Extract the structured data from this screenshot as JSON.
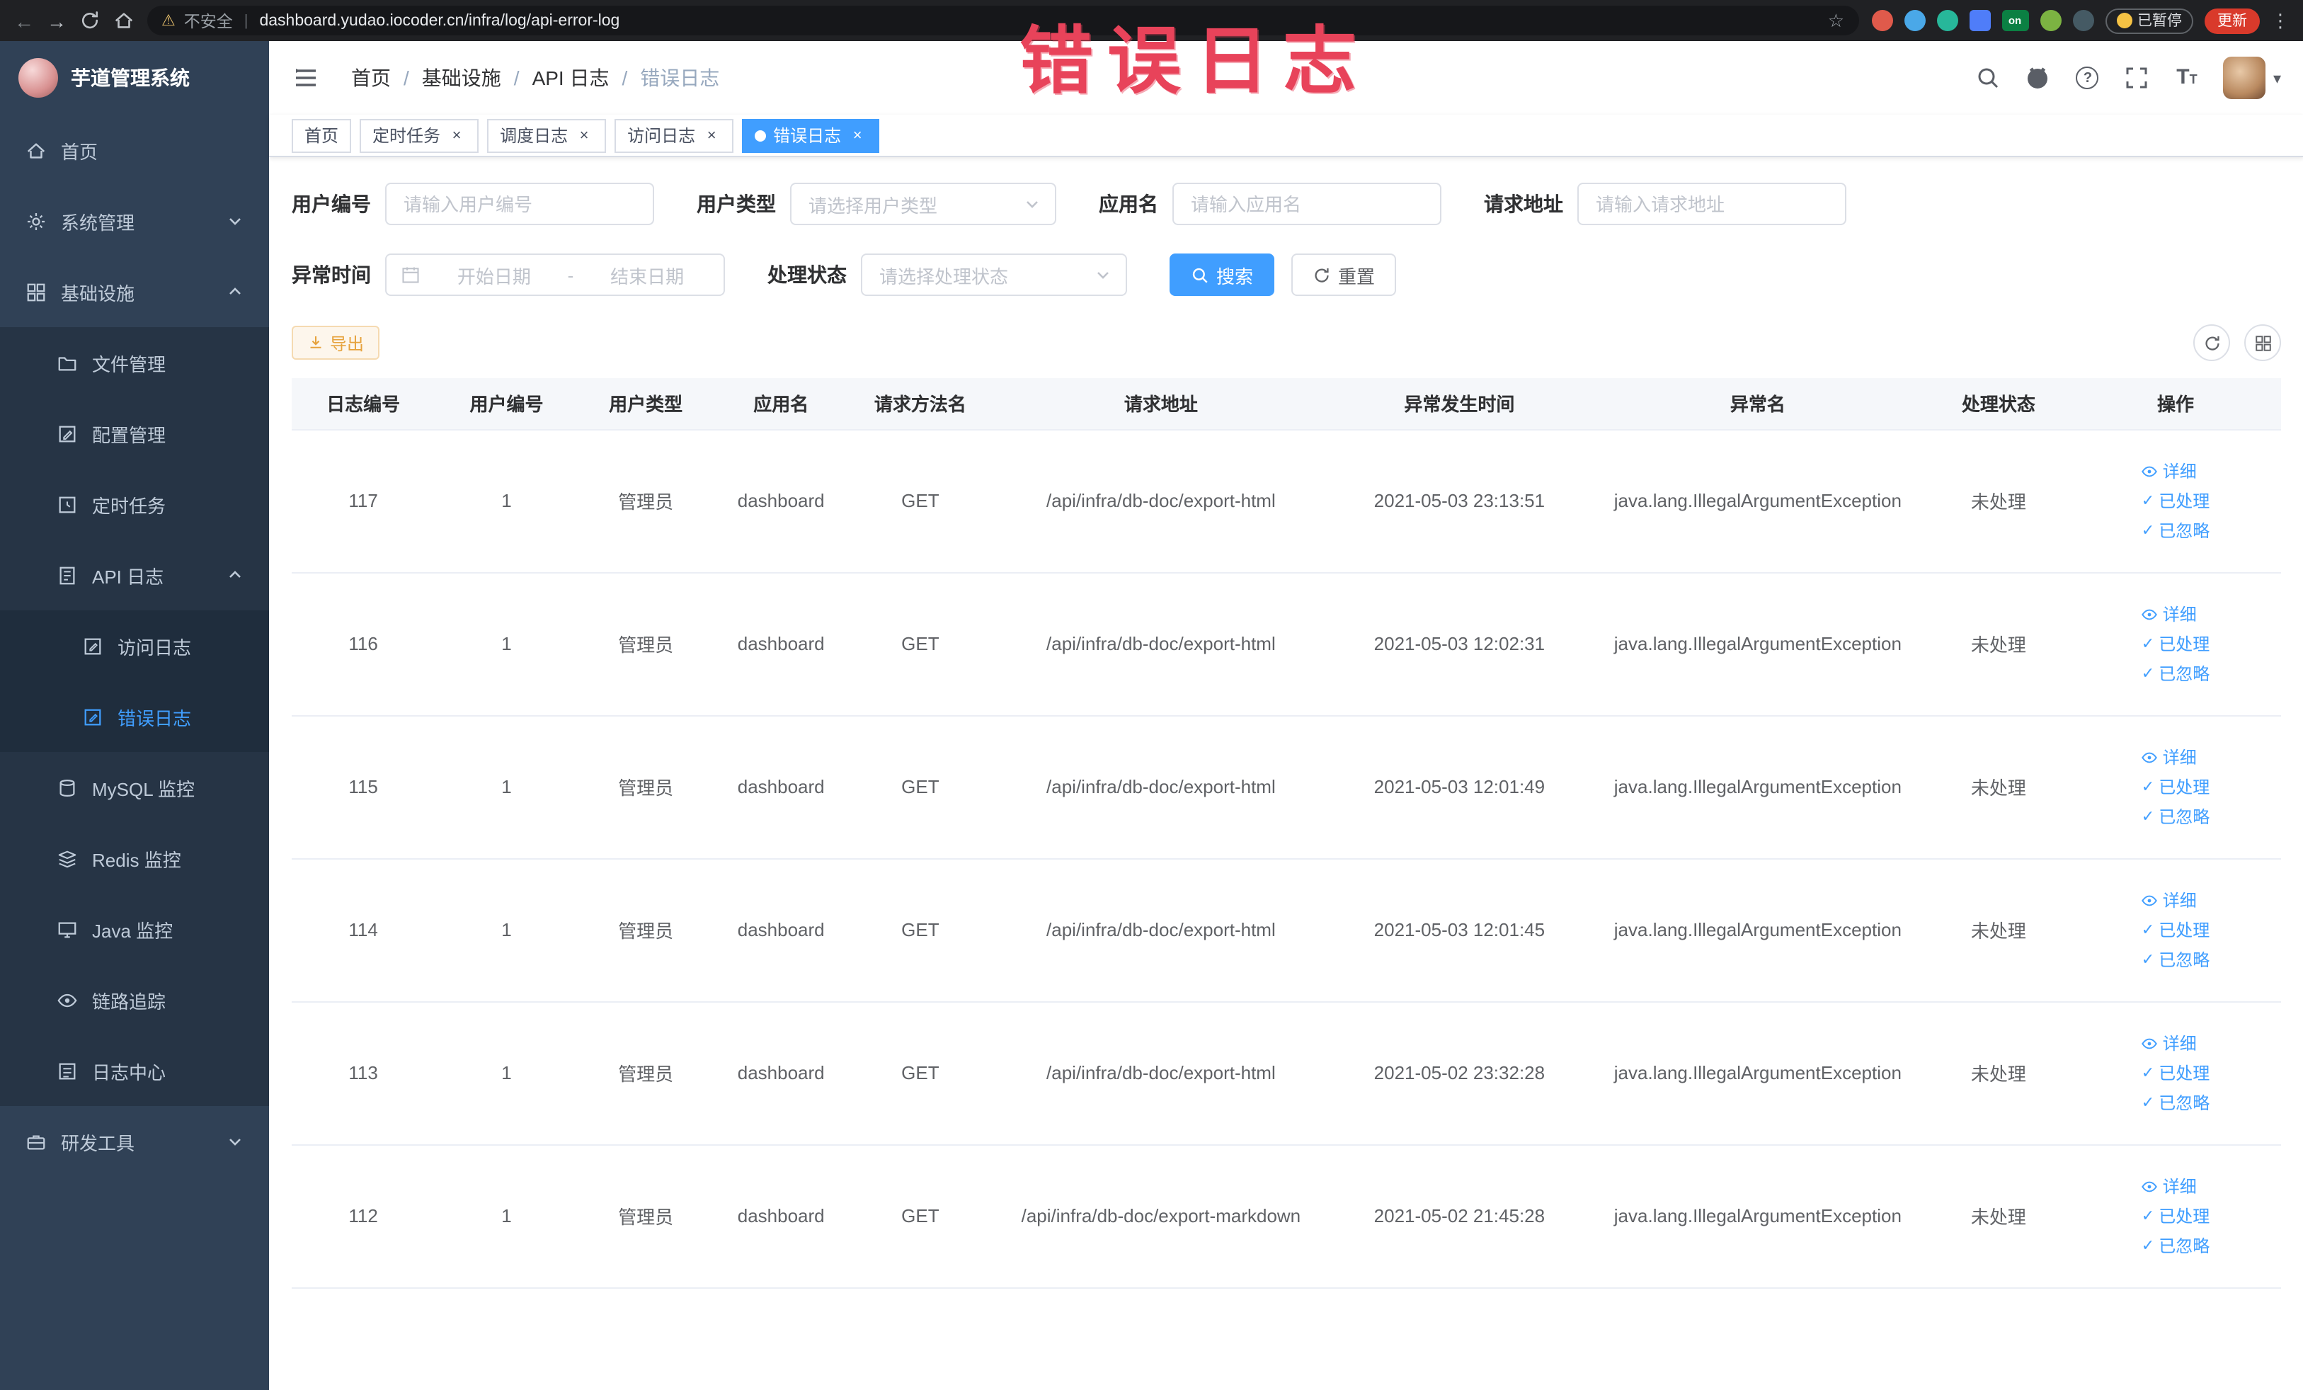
{
  "colors": {
    "accent": "#409EFF",
    "warning": "#E6A23C",
    "annotation": "#E8435A",
    "sidebar_bg": "#304156",
    "active_tab": "#409EFF"
  },
  "glyphs": {
    "back": "←",
    "forward": "→",
    "warning": "⚠",
    "pipe": "|",
    "star": "☆",
    "kebab": "⋮",
    "check": "✓",
    "close": "×",
    "caret": "▾",
    "separator": "/",
    "question": "?",
    "font": "T"
  },
  "browser": {
    "security_text": "不安全",
    "url": "dashboard.yudao.iocoder.cn/infra/log/api-error-log",
    "paused_label": "已暂停",
    "update_label": "更新",
    "extension_on_label": "on"
  },
  "annotation": {
    "text": "错误日志"
  },
  "sidebar": {
    "title": "芋道管理系统",
    "items": [
      {
        "label": "首页"
      },
      {
        "label": "系统管理"
      },
      {
        "label": "基础设施"
      },
      {
        "label": "文件管理"
      },
      {
        "label": "配置管理"
      },
      {
        "label": "定时任务"
      },
      {
        "label": "API 日志"
      },
      {
        "label": "访问日志"
      },
      {
        "label": "错误日志"
      },
      {
        "label": "MySQL 监控"
      },
      {
        "label": "Redis 监控"
      },
      {
        "label": "Java 监控"
      },
      {
        "label": "链路追踪"
      },
      {
        "label": "日志中心"
      },
      {
        "label": "研发工具"
      }
    ]
  },
  "breadcrumb": {
    "items": [
      "首页",
      "基础设施",
      "API 日志",
      "错误日志"
    ]
  },
  "tabs": [
    {
      "label": "首页"
    },
    {
      "label": "定时任务"
    },
    {
      "label": "调度日志"
    },
    {
      "label": "访问日志"
    },
    {
      "label": "错误日志"
    }
  ],
  "filters": {
    "user_id": {
      "label": "用户编号",
      "placeholder": "请输入用户编号"
    },
    "user_type": {
      "label": "用户类型",
      "placeholder": "请选择用户类型"
    },
    "app_name": {
      "label": "应用名",
      "placeholder": "请输入应用名"
    },
    "request_url": {
      "label": "请求地址",
      "placeholder": "请输入请求地址"
    },
    "exception_time": {
      "label": "异常时间",
      "start_placeholder": "开始日期",
      "separator": "-",
      "end_placeholder": "结束日期"
    },
    "process_status": {
      "label": "处理状态",
      "placeholder": "请选择处理状态"
    },
    "search_button": "搜索",
    "reset_button": "重置"
  },
  "toolbar": {
    "export_label": "导出"
  },
  "table": {
    "columns": [
      "日志编号",
      "用户编号",
      "用户类型",
      "应用名",
      "请求方法名",
      "请求地址",
      "异常发生时间",
      "异常名",
      "处理状态",
      "操作"
    ],
    "actions": [
      "详细",
      "已处理",
      "已忽略"
    ],
    "rows": [
      {
        "id": "117",
        "user_id": "1",
        "user_type": "管理员",
        "app": "dashboard",
        "method": "GET",
        "url": "/api/infra/db-doc/export-html",
        "time": "2021-05-03 23:13:51",
        "exception": "java.lang.IllegalArgumentException",
        "status": "未处理"
      },
      {
        "id": "116",
        "user_id": "1",
        "user_type": "管理员",
        "app": "dashboard",
        "method": "GET",
        "url": "/api/infra/db-doc/export-html",
        "time": "2021-05-03 12:02:31",
        "exception": "java.lang.IllegalArgumentException",
        "status": "未处理"
      },
      {
        "id": "115",
        "user_id": "1",
        "user_type": "管理员",
        "app": "dashboard",
        "method": "GET",
        "url": "/api/infra/db-doc/export-html",
        "time": "2021-05-03 12:01:49",
        "exception": "java.lang.IllegalArgumentException",
        "status": "未处理"
      },
      {
        "id": "114",
        "user_id": "1",
        "user_type": "管理员",
        "app": "dashboard",
        "method": "GET",
        "url": "/api/infra/db-doc/export-html",
        "time": "2021-05-03 12:01:45",
        "exception": "java.lang.IllegalArgumentException",
        "status": "未处理"
      },
      {
        "id": "113",
        "user_id": "1",
        "user_type": "管理员",
        "app": "dashboard",
        "method": "GET",
        "url": "/api/infra/db-doc/export-html",
        "time": "2021-05-02 23:32:28",
        "exception": "java.lang.IllegalArgumentException",
        "status": "未处理"
      },
      {
        "id": "112",
        "user_id": "1",
        "user_type": "管理员",
        "app": "dashboard",
        "method": "GET",
        "url": "/api/infra/db-doc/export-markdown",
        "time": "2021-05-02 21:45:28",
        "exception": "java.lang.IllegalArgumentException",
        "status": "未处理"
      }
    ]
  }
}
